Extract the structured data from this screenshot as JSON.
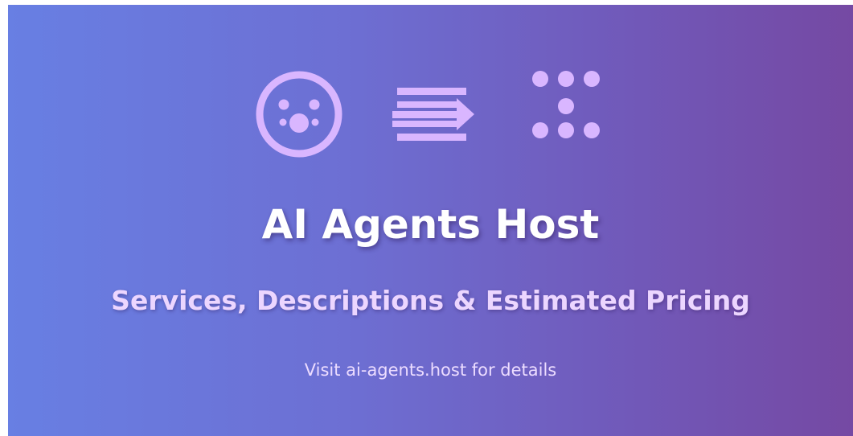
{
  "banner": {
    "title": "AI Agents Host",
    "subtitle": "Services, Descriptions & Estimated Pricing",
    "footer": "Visit ai-agents.host for details"
  },
  "icons": [
    "agent-hub-icon",
    "forward-arrow-icon",
    "dot-network-icon"
  ],
  "colors": {
    "gradient_start": "#687fe3",
    "gradient_end": "#7549a3",
    "icon_color": "#d9b6ff",
    "title_color": "#ffffff",
    "subtitle_color": "#ecd6ff"
  }
}
